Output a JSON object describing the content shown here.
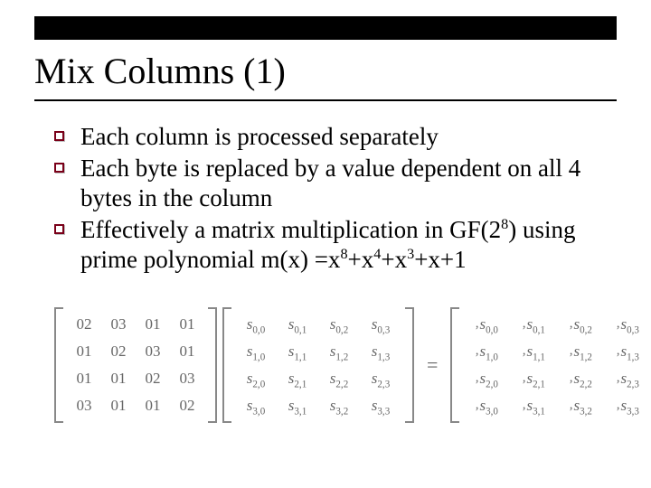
{
  "title": "Mix Columns (1)",
  "bullets": [
    "Each column is processed separately",
    "Each byte is replaced by a value dependent on all 4 bytes in the column",
    "Effectively a matrix multiplication in GF(2^8) using prime polynomial m(x) =x^8+x^4+x^3+x+1"
  ],
  "equation": {
    "coef": [
      [
        "02",
        "03",
        "01",
        "01"
      ],
      [
        "01",
        "02",
        "03",
        "01"
      ],
      [
        "01",
        "01",
        "02",
        "03"
      ],
      [
        "03",
        "01",
        "01",
        "02"
      ]
    ],
    "state_symbol": "s",
    "result_symbol": "s",
    "indices": [
      [
        "0,0",
        "0,1",
        "0,2",
        "0,3"
      ],
      [
        "1,0",
        "1,1",
        "1,2",
        "1,3"
      ],
      [
        "2,0",
        "2,1",
        "2,2",
        "2,3"
      ],
      [
        "3,0",
        "3,1",
        "3,2",
        "3,3"
      ]
    ],
    "equals": "="
  }
}
